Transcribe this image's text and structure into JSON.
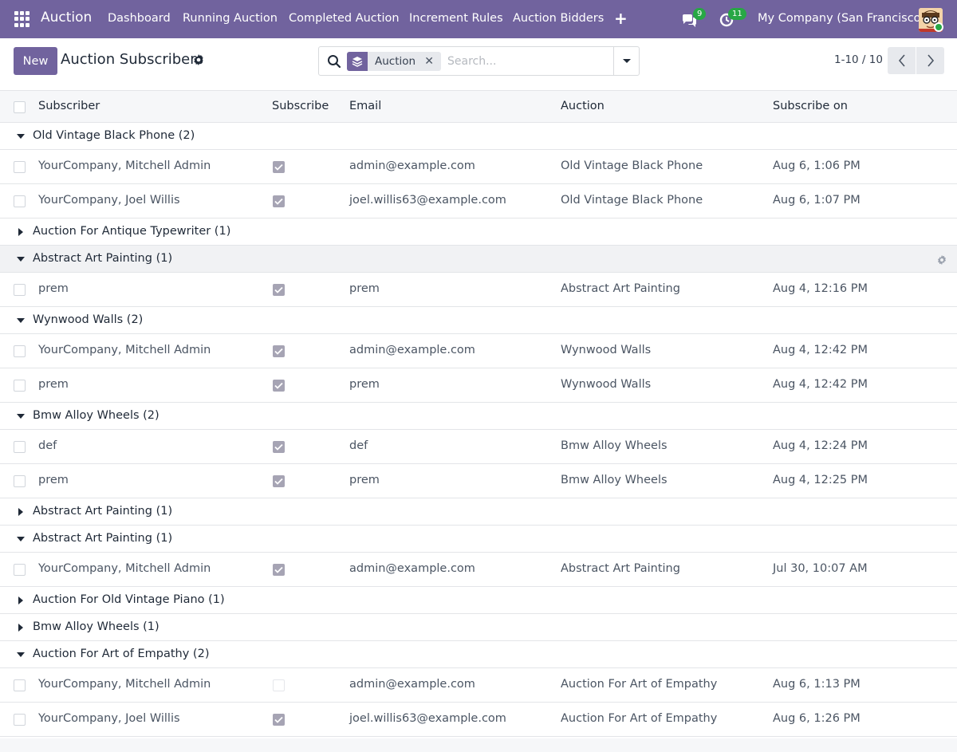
{
  "navbar": {
    "brand": "Auction",
    "menu": [
      "Dashboard",
      "Running Auction",
      "Completed Auction",
      "Increment Rules",
      "Auction Bidders"
    ],
    "messages_count": "9",
    "activities_count": "11",
    "company": "My Company (San Francisco)",
    "colors": {
      "primary": "#71639e",
      "badge": "#28a745"
    }
  },
  "control_panel": {
    "new_label": "New",
    "title": "Auction Subscribers",
    "facet_label": "Auction",
    "search_placeholder": "Search...",
    "pager": "1-10 / 10"
  },
  "table": {
    "columns": [
      "Subscriber",
      "Subscribe",
      "Email",
      "Auction",
      "Subscribe on"
    ],
    "groups": [
      {
        "label": "Old Vintage Black Phone (2)",
        "open": true,
        "rows": [
          {
            "subscriber": "YourCompany, Mitchell Admin",
            "subscribe": true,
            "email": "admin@example.com",
            "auction": "Old Vintage Black Phone",
            "subscribe_on": "Aug 6, 1:06 PM"
          },
          {
            "subscriber": "YourCompany, Joel Willis",
            "subscribe": true,
            "email": "joel.willis63@example.com",
            "auction": "Old Vintage Black Phone",
            "subscribe_on": "Aug 6, 1:07 PM"
          }
        ]
      },
      {
        "label": "Auction For Antique Typewriter (1)",
        "open": false,
        "rows": []
      },
      {
        "label": "Abstract Art Painting (1)",
        "open": true,
        "hover": true,
        "rows": [
          {
            "subscriber": "prem",
            "subscribe": true,
            "email": "prem",
            "auction": "Abstract Art Painting",
            "subscribe_on": "Aug 4, 12:16 PM"
          }
        ]
      },
      {
        "label": "Wynwood Walls (2)",
        "open": true,
        "rows": [
          {
            "subscriber": "YourCompany, Mitchell Admin",
            "subscribe": true,
            "email": "admin@example.com",
            "auction": "Wynwood Walls",
            "subscribe_on": "Aug 4, 12:42 PM"
          },
          {
            "subscriber": "prem",
            "subscribe": true,
            "email": "prem",
            "auction": "Wynwood Walls",
            "subscribe_on": "Aug 4, 12:42 PM"
          }
        ]
      },
      {
        "label": "Bmw Alloy Wheels (2)",
        "open": true,
        "rows": [
          {
            "subscriber": "def",
            "subscribe": true,
            "email": "def",
            "auction": "Bmw Alloy Wheels",
            "subscribe_on": "Aug 4, 12:24 PM"
          },
          {
            "subscriber": "prem",
            "subscribe": true,
            "email": "prem",
            "auction": "Bmw Alloy Wheels",
            "subscribe_on": "Aug 4, 12:25 PM"
          }
        ]
      },
      {
        "label": "Abstract Art Painting (1)",
        "open": false,
        "rows": []
      },
      {
        "label": "Abstract Art Painting (1)",
        "open": true,
        "rows": [
          {
            "subscriber": "YourCompany, Mitchell Admin",
            "subscribe": true,
            "email": "admin@example.com",
            "auction": "Abstract Art Painting",
            "subscribe_on": "Jul 30, 10:07 AM"
          }
        ]
      },
      {
        "label": "Auction For Old Vintage Piano (1)",
        "open": false,
        "rows": []
      },
      {
        "label": "Bmw Alloy Wheels (1)",
        "open": false,
        "rows": []
      },
      {
        "label": "Auction For Art of Empathy (2)",
        "open": true,
        "rows": [
          {
            "subscriber": "YourCompany, Mitchell Admin",
            "subscribe": false,
            "email": "admin@example.com",
            "auction": "Auction For Art of Empathy",
            "subscribe_on": "Aug 6, 1:13 PM"
          },
          {
            "subscriber": "YourCompany, Joel Willis",
            "subscribe": true,
            "email": "joel.willis63@example.com",
            "auction": "Auction For Art of Empathy",
            "subscribe_on": "Aug 6, 1:26 PM"
          }
        ]
      }
    ]
  }
}
